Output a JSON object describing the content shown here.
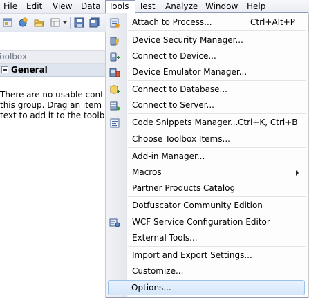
{
  "menubar": {
    "items": [
      {
        "label": "File"
      },
      {
        "label": "Edit"
      },
      {
        "label": "View"
      },
      {
        "label": "Data"
      },
      {
        "label": "Tools"
      },
      {
        "label": "Test"
      },
      {
        "label": "Analyze"
      },
      {
        "label": "Window"
      },
      {
        "label": "Help"
      }
    ],
    "open_menu": "Tools"
  },
  "toolbar": {
    "icons": [
      "new-project-icon",
      "add-item-icon",
      "open-folder-icon",
      "layout-icon",
      "save-icon",
      "save-all-icon"
    ]
  },
  "toolbox": {
    "title": "Toolbox",
    "group": "General",
    "empty_message": [
      "There are no usable controls in",
      "this group. Drag an item onto",
      "text to add it to the toolbox."
    ]
  },
  "tools_menu": {
    "items": [
      {
        "label": "Attach to Process...",
        "shortcut": "Ctrl+Alt+P",
        "icon": "attach-process-icon"
      },
      {
        "label": "Device Security Manager...",
        "shortcut": "",
        "icon": "device-security-icon"
      },
      {
        "label": "Connect to Device...",
        "shortcut": "",
        "icon": "connect-device-icon"
      },
      {
        "label": "Device Emulator Manager...",
        "shortcut": "",
        "icon": "emulator-manager-icon"
      },
      {
        "label": "Connect to Database...",
        "shortcut": "",
        "icon": "connect-database-icon"
      },
      {
        "label": "Connect to Server...",
        "shortcut": "",
        "icon": "connect-server-icon"
      },
      {
        "label": "Code Snippets Manager...",
        "shortcut": "Ctrl+K, Ctrl+B",
        "icon": "code-snippets-icon"
      },
      {
        "label": "Choose Toolbox Items...",
        "shortcut": ""
      },
      {
        "label": "Add-in Manager...",
        "shortcut": ""
      },
      {
        "label": "Macros",
        "shortcut": "",
        "submenu": true
      },
      {
        "label": "Partner Products Catalog",
        "shortcut": ""
      },
      {
        "label": "Dotfuscator Community Edition",
        "shortcut": ""
      },
      {
        "label": "WCF Service Configuration Editor",
        "shortcut": "",
        "icon": "wcf-config-icon"
      },
      {
        "label": "External Tools...",
        "shortcut": ""
      },
      {
        "label": "Import and Export Settings...",
        "shortcut": ""
      },
      {
        "label": "Customize...",
        "shortcut": ""
      },
      {
        "label": "Options...",
        "shortcut": "",
        "highlighted": true
      }
    ]
  }
}
